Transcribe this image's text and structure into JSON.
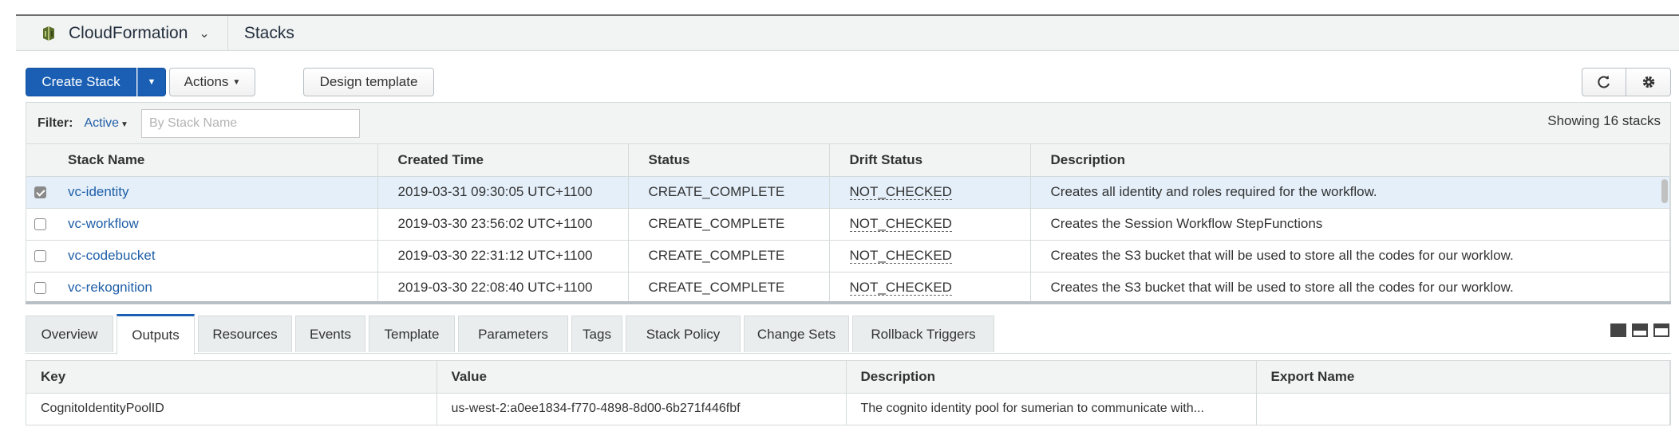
{
  "header": {
    "service": "CloudFormation",
    "breadcrumb": "Stacks",
    "logo_color": "#5a6e2b"
  },
  "toolbar": {
    "create_stack": "Create Stack",
    "actions": "Actions",
    "design_template": "Design template",
    "refresh_icon": "refresh-icon",
    "settings_icon": "gear-icon"
  },
  "filter": {
    "label": "Filter:",
    "active": "Active",
    "placeholder": "By Stack Name",
    "showing": "Showing 16 stacks"
  },
  "stacks": {
    "columns": [
      "Stack Name",
      "Created Time",
      "Status",
      "Drift Status",
      "Description"
    ],
    "rows": [
      {
        "checked": true,
        "name": "vc-identity",
        "created": "2019-03-31 09:30:05 UTC+1100",
        "status": "CREATE_COMPLETE",
        "drift": "NOT_CHECKED",
        "description": "Creates all identity and roles required for the workflow."
      },
      {
        "checked": false,
        "name": "vc-workflow",
        "created": "2019-03-30 23:56:02 UTC+1100",
        "status": "CREATE_COMPLETE",
        "drift": "NOT_CHECKED",
        "description": "Creates the Session Workflow StepFunctions"
      },
      {
        "checked": false,
        "name": "vc-codebucket",
        "created": "2019-03-30 22:31:12 UTC+1100",
        "status": "CREATE_COMPLETE",
        "drift": "NOT_CHECKED",
        "description": "Creates the S3 bucket that will be used to store all the codes for our worklow."
      },
      {
        "checked": false,
        "name": "vc-rekognition",
        "created": "2019-03-30 22:08:40 UTC+1100",
        "status": "CREATE_COMPLETE",
        "drift": "NOT_CHECKED",
        "description": "Creates the S3 bucket that will be used to store all the codes for our worklow."
      }
    ]
  },
  "tabs": [
    "Overview",
    "Outputs",
    "Resources",
    "Events",
    "Template",
    "Parameters",
    "Tags",
    "Stack Policy",
    "Change Sets",
    "Rollback Triggers"
  ],
  "active_tab": "Outputs",
  "outputs": {
    "columns": [
      "Key",
      "Value",
      "Description",
      "Export Name"
    ],
    "rows": [
      {
        "key": "CognitoIdentityPoolID",
        "value": "us-west-2:a0ee1834-f770-4898-8d00-6b271f446fbf",
        "description": "The cognito identity pool for sumerian to communicate with...",
        "export": ""
      }
    ]
  },
  "colors": {
    "primary": "#1a5fb4",
    "link": "#1f5fa8",
    "status_ok": "#1d8102"
  }
}
